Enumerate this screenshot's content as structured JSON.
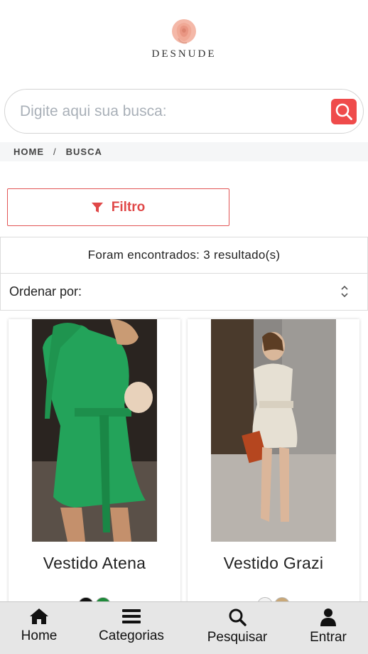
{
  "brand": {
    "name": "DESNUDE"
  },
  "search": {
    "placeholder": "Digite aqui sua busca:"
  },
  "breadcrumb": {
    "items": [
      "HOME",
      "BUSCA"
    ],
    "separator": "/"
  },
  "filter": {
    "label": "Filtro"
  },
  "results": {
    "text": "Foram encontrados: 3 resultado(s)"
  },
  "sort": {
    "label": "Ordenar por:"
  },
  "products": [
    {
      "name": "Vestido Atena",
      "swatches": [
        "#111111",
        "#1f8a3a"
      ]
    },
    {
      "name": "Vestido Grazi",
      "swatches": [
        "#f2f2f2",
        "#c9a878"
      ]
    }
  ],
  "bottom_nav": [
    {
      "label": "Home",
      "icon": "home-icon"
    },
    {
      "label": "Categorias",
      "icon": "menu-icon"
    },
    {
      "label": "Pesquisar",
      "icon": "search-icon"
    },
    {
      "label": "Entrar",
      "icon": "user-icon"
    }
  ],
  "colors": {
    "accent": "#ef4b4b",
    "nav_bg": "#e6e6e6"
  }
}
